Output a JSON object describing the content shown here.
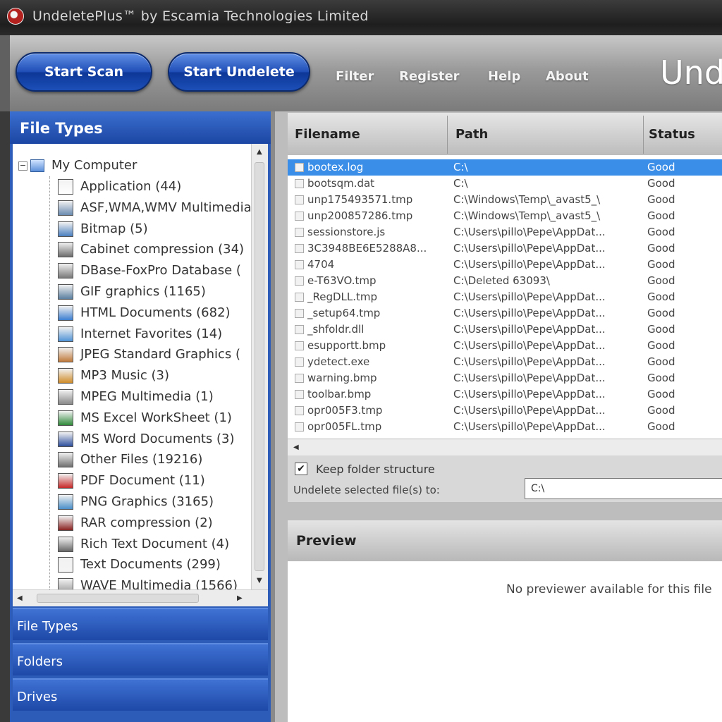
{
  "window": {
    "title": "UndeletePlus™ by Escamia Technologies Limited"
  },
  "toolbar": {
    "start_scan": "Start Scan",
    "start_undelete": "Start Undelete",
    "links": [
      "Filter",
      "Register",
      "Help",
      "About"
    ],
    "brand": "Und"
  },
  "left_panel": {
    "header": "File Types",
    "root": "My Computer",
    "items": [
      {
        "label": "Application (44)",
        "icon": "application-icon"
      },
      {
        "label": "ASF,WMA,WMV Multimedia",
        "icon": "multimedia-icon"
      },
      {
        "label": "Bitmap (5)",
        "icon": "bitmap-icon"
      },
      {
        "label": "Cabinet compression (34)",
        "icon": "cabinet-icon"
      },
      {
        "label": "DBase-FoxPro Database (",
        "icon": "database-icon"
      },
      {
        "label": "GIF graphics (1165)",
        "icon": "gif-icon"
      },
      {
        "label": "HTML Documents (682)",
        "icon": "html-icon"
      },
      {
        "label": "Internet Favorites (14)",
        "icon": "favorites-icon"
      },
      {
        "label": "JPEG Standard Graphics (",
        "icon": "jpeg-icon"
      },
      {
        "label": "MP3 Music (3)",
        "icon": "mp3-icon"
      },
      {
        "label": "MPEG Multimedia (1)",
        "icon": "mpeg-icon"
      },
      {
        "label": "MS Excel WorkSheet (1)",
        "icon": "excel-icon"
      },
      {
        "label": "MS Word Documents (3)",
        "icon": "word-icon"
      },
      {
        "label": "Other Files (19216)",
        "icon": "other-files-icon"
      },
      {
        "label": "PDF Document (11)",
        "icon": "pdf-icon"
      },
      {
        "label": "PNG Graphics (3165)",
        "icon": "png-icon"
      },
      {
        "label": "RAR compression (2)",
        "icon": "rar-icon"
      },
      {
        "label": "Rich Text Document (4)",
        "icon": "rtf-icon"
      },
      {
        "label": "Text Documents (299)",
        "icon": "text-icon"
      },
      {
        "label": "WAVE Multimedia (1566)",
        "icon": "wave-icon"
      }
    ],
    "accordion": [
      "File Types",
      "Folders",
      "Drives"
    ]
  },
  "grid": {
    "columns": [
      "Filename",
      "Path",
      "Status"
    ],
    "rows": [
      {
        "filename": "bootex.log",
        "path": "C:\\",
        "status": "Good"
      },
      {
        "filename": "bootsqm.dat",
        "path": "C:\\",
        "status": "Good"
      },
      {
        "filename": "unp175493571.tmp",
        "path": "C:\\Windows\\Temp\\_avast5_\\",
        "status": "Good"
      },
      {
        "filename": "unp200857286.tmp",
        "path": "C:\\Windows\\Temp\\_avast5_\\",
        "status": "Good"
      },
      {
        "filename": "sessionstore.js",
        "path": "C:\\Users\\pillo\\Pepe\\AppDat...",
        "status": "Good"
      },
      {
        "filename": "3C3948BE6E5288A8...",
        "path": "C:\\Users\\pillo\\Pepe\\AppDat...",
        "status": "Good"
      },
      {
        "filename": "4704",
        "path": "C:\\Users\\pillo\\Pepe\\AppDat...",
        "status": "Good"
      },
      {
        "filename": "e-T63VO.tmp",
        "path": "C:\\Deleted 63093\\",
        "status": "Good"
      },
      {
        "filename": "_RegDLL.tmp",
        "path": "C:\\Users\\pillo\\Pepe\\AppDat...",
        "status": "Good"
      },
      {
        "filename": "_setup64.tmp",
        "path": "C:\\Users\\pillo\\Pepe\\AppDat...",
        "status": "Good"
      },
      {
        "filename": "_shfoldr.dll",
        "path": "C:\\Users\\pillo\\Pepe\\AppDat...",
        "status": "Good"
      },
      {
        "filename": "esupportt.bmp",
        "path": "C:\\Users\\pillo\\Pepe\\AppDat...",
        "status": "Good"
      },
      {
        "filename": "ydetect.exe",
        "path": "C:\\Users\\pillo\\Pepe\\AppDat...",
        "status": "Good"
      },
      {
        "filename": "warning.bmp",
        "path": "C:\\Users\\pillo\\Pepe\\AppDat...",
        "status": "Good"
      },
      {
        "filename": "toolbar.bmp",
        "path": "C:\\Users\\pillo\\Pepe\\AppDat...",
        "status": "Good"
      },
      {
        "filename": "opr005F3.tmp",
        "path": "C:\\Users\\pillo\\Pepe\\AppDat...",
        "status": "Good"
      },
      {
        "filename": "opr005FL.tmp",
        "path": "C:\\Users\\pillo\\Pepe\\AppDat...",
        "status": "Good"
      }
    ]
  },
  "options": {
    "keep_folder": "Keep folder structure",
    "undelete_to": "Undelete selected file(s) to:",
    "destination": "C:\\"
  },
  "preview": {
    "header": "Preview",
    "message": "No previewer available for this file"
  }
}
